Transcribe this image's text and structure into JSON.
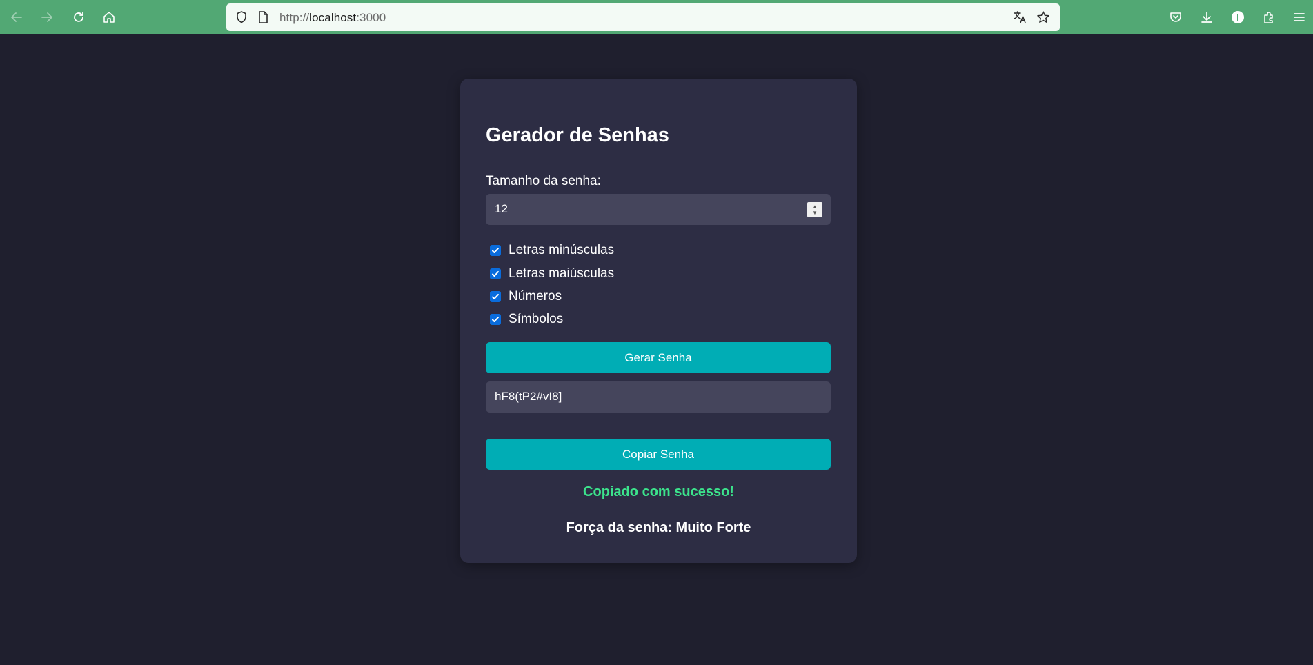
{
  "browser": {
    "url_prefix": "http://",
    "url_host": "localhost",
    "url_port": ":3000",
    "icons": {
      "back": "arrow-left-icon",
      "forward": "arrow-right-icon",
      "reload": "reload-icon",
      "home": "home-icon",
      "shield": "shield-icon",
      "page": "page-icon",
      "translate": "translate-icon",
      "bookmark": "star-icon",
      "pocket": "pocket-icon",
      "downloads": "download-icon",
      "account": "account-icon",
      "extensions": "extensions-icon",
      "menu": "hamburger-menu-icon"
    },
    "toolbar_color": "#52a874"
  },
  "app": {
    "title": "Gerador de Senhas",
    "length_label": "Tamanho da senha:",
    "length_value": "12",
    "options": [
      {
        "label": "Letras minúsculas",
        "checked": true
      },
      {
        "label": "Letras maiúsculas",
        "checked": true
      },
      {
        "label": "Números",
        "checked": true
      },
      {
        "label": "Símbolos",
        "checked": true
      }
    ],
    "generate_button": "Gerar Senha",
    "password_value": "hF8(tP2#vI8]",
    "copy_button": "Copiar Senha",
    "copy_status": "Copiado com sucesso!",
    "strength_label": "Força da senha:",
    "strength_value": "Muito Forte"
  },
  "colors": {
    "background": "#1f1f2e",
    "card": "#2d2d44",
    "field": "#45455c",
    "accent": "#00adb5",
    "success": "#3ce38c",
    "checkbox": "#0a6cdc"
  }
}
